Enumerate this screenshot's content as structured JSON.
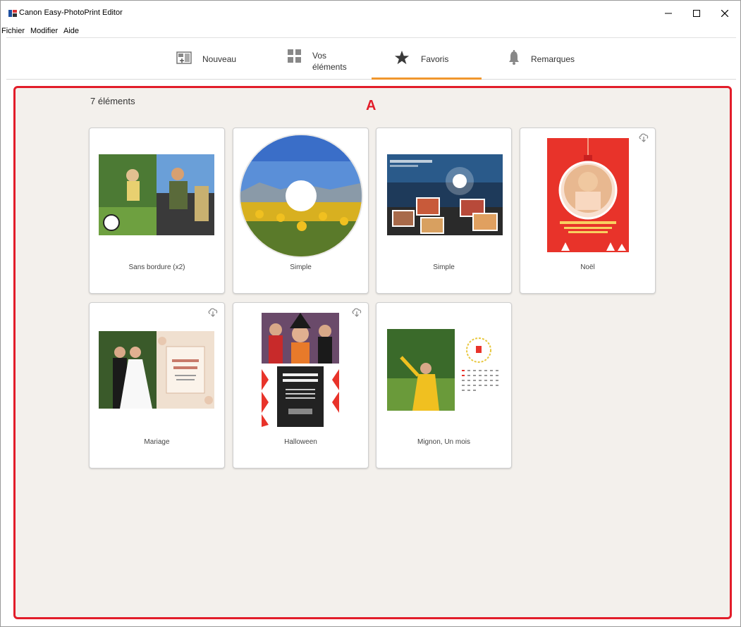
{
  "window": {
    "title": "Canon Easy-PhotoPrint Editor"
  },
  "menu": {
    "file": "Fichier",
    "edit": "Modifier",
    "help": "Aide"
  },
  "tabs": [
    {
      "label": "Nouveau"
    },
    {
      "label": "Vos\néléments"
    },
    {
      "label": "Favoris",
      "selected": true
    },
    {
      "label": "Remarques"
    }
  ],
  "content": {
    "count": "7 éléments",
    "marker": "A",
    "cards": [
      {
        "label": "Sans bordure (x2)",
        "downloadable": false
      },
      {
        "label": "Simple",
        "downloadable": false
      },
      {
        "label": "Simple",
        "downloadable": false
      },
      {
        "label": "Noël",
        "downloadable": true
      },
      {
        "label": "Mariage",
        "downloadable": true
      },
      {
        "label": "Halloween",
        "downloadable": true
      },
      {
        "label": "Mignon, Un mois",
        "downloadable": false
      }
    ]
  },
  "colors": {
    "accent": "#f0962d",
    "highlight_border": "#e21d2a",
    "content_bg": "#f3f0ec"
  },
  "icons": [
    "minimize-icon",
    "maximize-icon",
    "close-icon",
    "new-icon",
    "grid-icon",
    "star-icon",
    "bell-icon",
    "cloud-download-icon"
  ]
}
